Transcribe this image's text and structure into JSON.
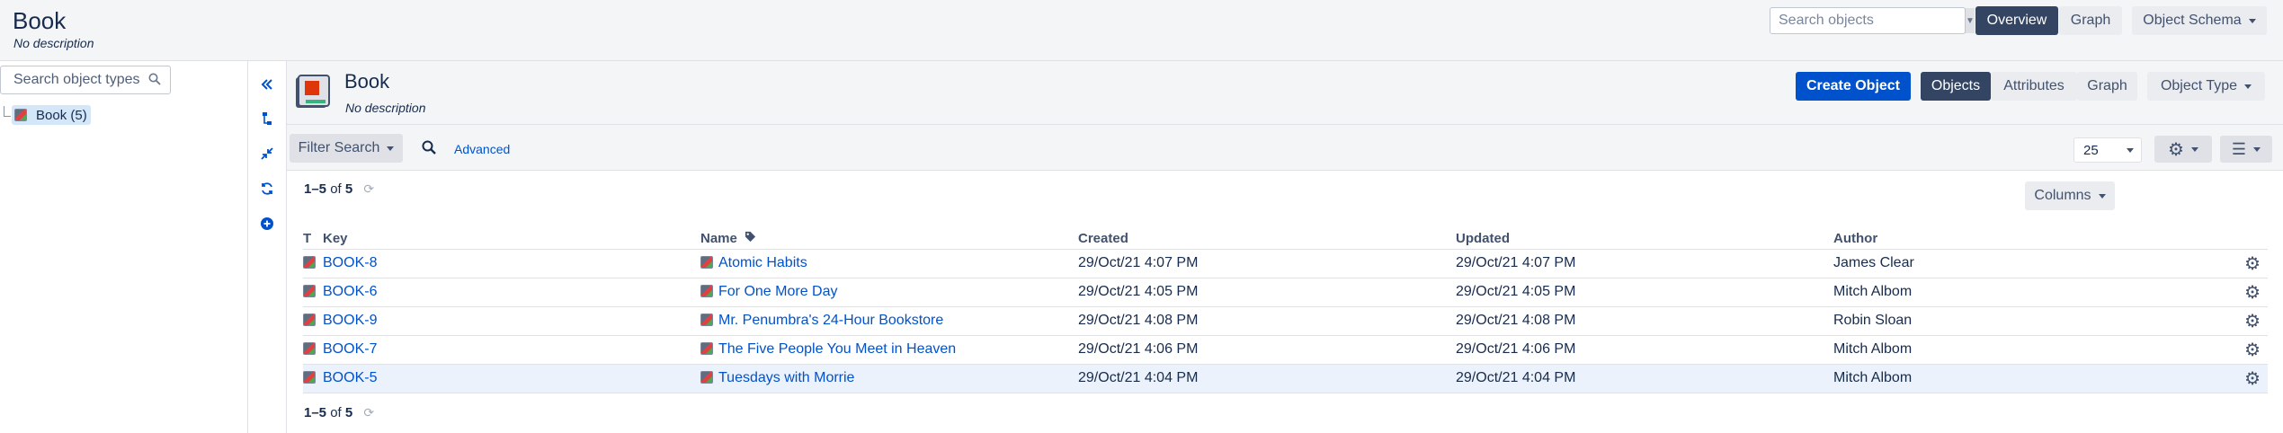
{
  "header": {
    "title": "Book",
    "description": "No description",
    "search_placeholder": "Search objects",
    "overview_label": "Overview",
    "graph_label": "Graph",
    "schema_label": "Object Schema"
  },
  "sidebar": {
    "search_placeholder": "Search object types",
    "tree_item": "Book (5)"
  },
  "object_type": {
    "title": "Book",
    "description": "No description",
    "create_label": "Create Object",
    "objects_label": "Objects",
    "attributes_label": "Attributes",
    "graph_label": "Graph",
    "type_menu_label": "Object Type"
  },
  "filter": {
    "filter_search_label": "Filter Search",
    "advanced_label": "Advanced",
    "page_size": "25"
  },
  "results": {
    "range": "1–5",
    "of": "of",
    "total": "5",
    "columns_label": "Columns"
  },
  "table": {
    "headers": {
      "t": "T",
      "key": "Key",
      "name": "Name",
      "created": "Created",
      "updated": "Updated",
      "author": "Author"
    },
    "rows": [
      {
        "key": "BOOK-8",
        "name": "Atomic Habits",
        "created": "29/Oct/21 4:07 PM",
        "updated": "29/Oct/21 4:07 PM",
        "author": "James Clear"
      },
      {
        "key": "BOOK-6",
        "name": "For One More Day",
        "created": "29/Oct/21 4:05 PM",
        "updated": "29/Oct/21 4:05 PM",
        "author": "Mitch Albom"
      },
      {
        "key": "BOOK-9",
        "name": "Mr. Penumbra's 24-Hour Bookstore",
        "created": "29/Oct/21 4:08 PM",
        "updated": "29/Oct/21 4:08 PM",
        "author": "Robin Sloan"
      },
      {
        "key": "BOOK-7",
        "name": "The Five People You Meet in Heaven",
        "created": "29/Oct/21 4:06 PM",
        "updated": "29/Oct/21 4:06 PM",
        "author": "Mitch Albom"
      },
      {
        "key": "BOOK-5",
        "name": "Tuesdays with Morrie",
        "created": "29/Oct/21 4:04 PM",
        "updated": "29/Oct/21 4:04 PM",
        "author": "Mitch Albom"
      }
    ]
  },
  "colors": {
    "primary": "#0052cc",
    "dark_button": "#344563",
    "selected_tree": "#d3e7f8",
    "row_highlight": "#ebf2fb"
  }
}
